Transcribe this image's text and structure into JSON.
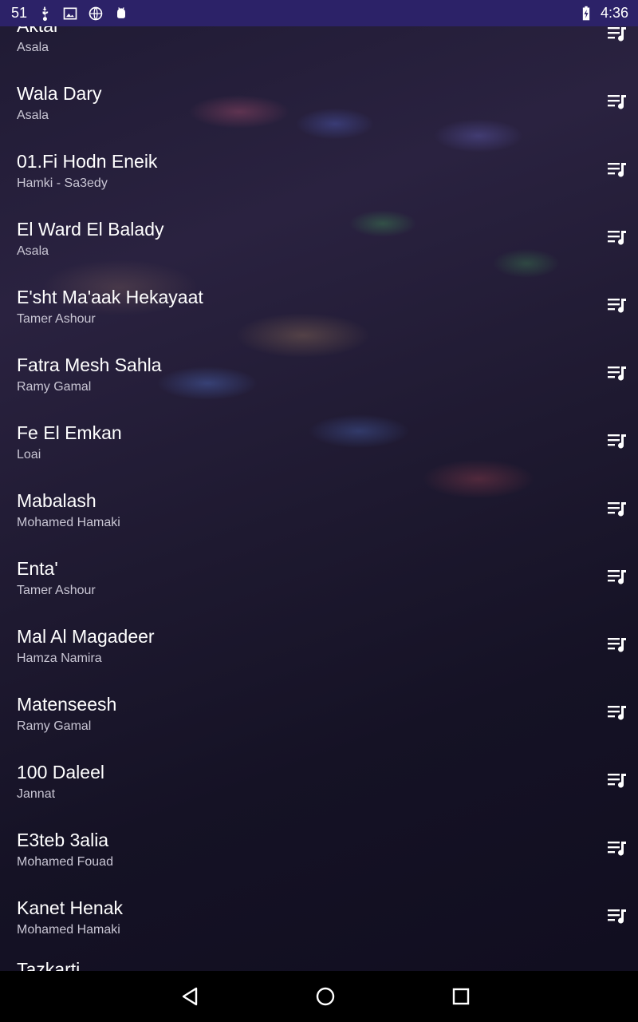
{
  "status_bar": {
    "notification_count": "51",
    "time": "4:36",
    "icons": [
      "usb-icon",
      "image-icon",
      "vpn-globe-icon",
      "android-debug-icon",
      "battery-charging-icon"
    ]
  },
  "songs": [
    {
      "title": "Aktar",
      "artist": "Asala"
    },
    {
      "title": "Wala Dary",
      "artist": "Asala"
    },
    {
      "title": "01.Fi Hodn Eneik",
      "artist": "Hamki - Sa3edy"
    },
    {
      "title": "El Ward El Balady",
      "artist": "Asala"
    },
    {
      "title": "E'sht Ma'aak Hekayaat",
      "artist": "Tamer Ashour"
    },
    {
      "title": "Fatra Mesh Sahla",
      "artist": "Ramy Gamal"
    },
    {
      "title": "Fe El Emkan",
      "artist": "Loai"
    },
    {
      "title": "Mabalash",
      "artist": "Mohamed Hamaki"
    },
    {
      "title": "Enta'",
      "artist": "Tamer Ashour"
    },
    {
      "title": "Mal Al Magadeer",
      "artist": "Hamza Namira"
    },
    {
      "title": "Matenseesh",
      "artist": "Ramy Gamal"
    },
    {
      "title": "100 Daleel",
      "artist": "Jannat"
    },
    {
      "title": "E3teb 3alia",
      "artist": "Mohamed Fouad"
    },
    {
      "title": "Kanet Henak",
      "artist": "Mohamed Hamaki"
    },
    {
      "title": "Tazkarti",
      "artist": ""
    }
  ],
  "row_icon": "playlist-add-icon",
  "nav_bar": {
    "icons": [
      "back-icon",
      "home-icon",
      "recents-icon"
    ]
  },
  "colors": {
    "status_bar": "#2c2268",
    "nav_bar": "#000000",
    "title_text": "#ffffff",
    "artist_text": "#c9c6d4"
  }
}
